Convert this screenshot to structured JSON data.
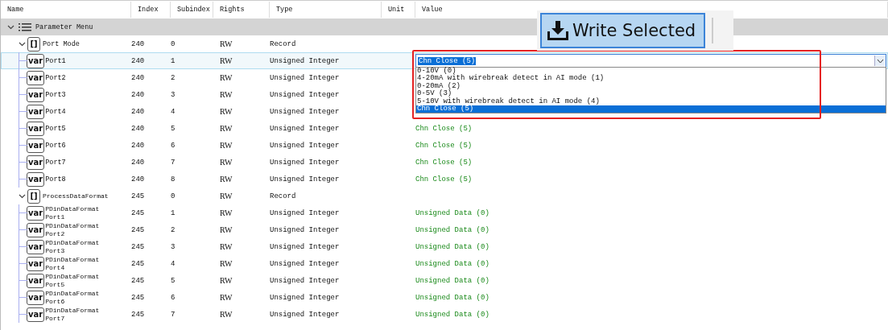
{
  "columns": [
    "Name",
    "Index",
    "Subindex",
    "Rights",
    "Type",
    "Unit",
    "Value"
  ],
  "tree": {
    "name": "Parameter Menu",
    "kind": "menu",
    "expanded": true,
    "selected": false,
    "children": [
      {
        "name": "Port Mode",
        "kind": "record",
        "badge": "[]",
        "expanded": true,
        "selected": false,
        "index": "240",
        "subindex": "0",
        "rights": "RW",
        "type": "Record",
        "children": [
          {
            "name": "Port1",
            "kind": "var",
            "badge": "var",
            "selected": true,
            "index": "240",
            "subindex": "1",
            "rights": "RW",
            "type": "Unsigned Integer",
            "editor": {
              "value": "Chn Close (5)",
              "options": [
                {
                  "label": "0-10V (0)",
                  "selected": false
                },
                {
                  "label": "4-20mA with wirebreak detect in AI mode (1)",
                  "selected": false
                },
                {
                  "label": "0-20mA (2)",
                  "selected": false
                },
                {
                  "label": "0-5V (3)",
                  "selected": false
                },
                {
                  "label": "5-10V with wirebreak detect in AI mode (4)",
                  "selected": false
                },
                {
                  "label": "Chn Close (5)",
                  "selected": true
                }
              ]
            }
          },
          {
            "name": "Port2",
            "kind": "var",
            "badge": "var",
            "selected": false,
            "index": "240",
            "subindex": "2",
            "rights": "RW",
            "type": "Unsigned Integer"
          },
          {
            "name": "Port3",
            "kind": "var",
            "badge": "var",
            "selected": false,
            "index": "240",
            "subindex": "3",
            "rights": "RW",
            "type": "Unsigned Integer"
          },
          {
            "name": "Port4",
            "kind": "var",
            "badge": "var",
            "selected": false,
            "index": "240",
            "subindex": "4",
            "rights": "RW",
            "type": "Unsigned Integer"
          },
          {
            "name": "Port5",
            "kind": "var",
            "badge": "var",
            "selected": false,
            "index": "240",
            "subindex": "5",
            "rights": "RW",
            "type": "Unsigned Integer",
            "value": "Chn Close (5)"
          },
          {
            "name": "Port6",
            "kind": "var",
            "badge": "var",
            "selected": false,
            "index": "240",
            "subindex": "6",
            "rights": "RW",
            "type": "Unsigned Integer",
            "value": "Chn Close (5)"
          },
          {
            "name": "Port7",
            "kind": "var",
            "badge": "var",
            "selected": false,
            "index": "240",
            "subindex": "7",
            "rights": "RW",
            "type": "Unsigned Integer",
            "value": "Chn Close (5)"
          },
          {
            "name": "Port8",
            "kind": "var",
            "badge": "var",
            "selected": false,
            "index": "240",
            "subindex": "8",
            "rights": "RW",
            "type": "Unsigned Integer",
            "value": "Chn Close (5)"
          }
        ]
      },
      {
        "name": "ProcessDataFormat",
        "kind": "record",
        "badge": "[]",
        "expanded": true,
        "selected": false,
        "index": "245",
        "subindex": "0",
        "rights": "RW",
        "type": "Record",
        "children": [
          {
            "name": "PDinDataFormat Port1",
            "kind": "var",
            "badge": "var",
            "selected": false,
            "index": "245",
            "subindex": "1",
            "rights": "RW",
            "type": "Unsigned Integer",
            "value": "Unsigned Data (0)"
          },
          {
            "name": "PDinDataFormat Port2",
            "kind": "var",
            "badge": "var",
            "selected": false,
            "index": "245",
            "subindex": "2",
            "rights": "RW",
            "type": "Unsigned Integer",
            "value": "Unsigned Data (0)"
          },
          {
            "name": "PDinDataFormat Port3",
            "kind": "var",
            "badge": "var",
            "selected": false,
            "index": "245",
            "subindex": "3",
            "rights": "RW",
            "type": "Unsigned Integer",
            "value": "Unsigned Data (0)"
          },
          {
            "name": "PDinDataFormat Port4",
            "kind": "var",
            "badge": "var",
            "selected": false,
            "index": "245",
            "subindex": "4",
            "rights": "RW",
            "type": "Unsigned Integer",
            "value": "Unsigned Data (0)"
          },
          {
            "name": "PDinDataFormat Port5",
            "kind": "var",
            "badge": "var",
            "selected": false,
            "index": "245",
            "subindex": "5",
            "rights": "RW",
            "type": "Unsigned Integer",
            "value": "Unsigned Data (0)"
          },
          {
            "name": "PDinDataFormat Port6",
            "kind": "var",
            "badge": "var",
            "selected": false,
            "index": "245",
            "subindex": "6",
            "rights": "RW",
            "type": "Unsigned Integer",
            "value": "Unsigned Data (0)"
          },
          {
            "name": "PDinDataFormat Port7",
            "kind": "var",
            "badge": "var",
            "selected": false,
            "index": "245",
            "subindex": "7",
            "rights": "RW",
            "type": "Unsigned Integer",
            "value": "Unsigned Data (0)"
          }
        ]
      }
    ]
  },
  "write_button": {
    "label": "Write Selected"
  }
}
